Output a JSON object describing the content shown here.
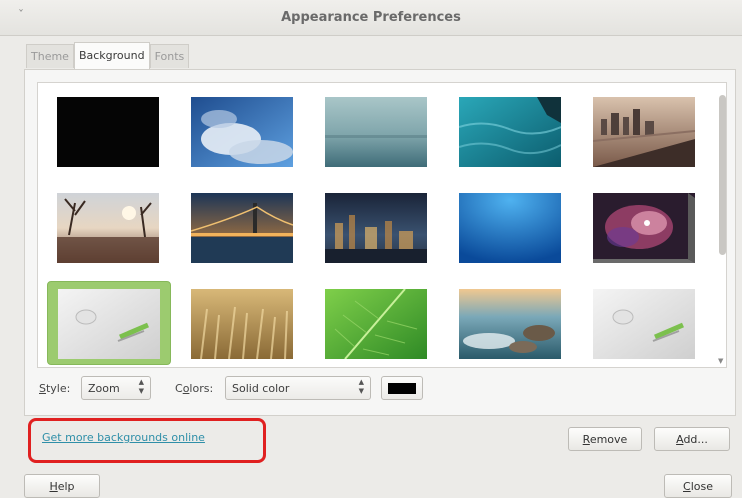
{
  "window": {
    "title": "Appearance Preferences",
    "menu_glyph": "ˇ"
  },
  "tabs": [
    {
      "label": "Theme",
      "active": false
    },
    {
      "label": "Background",
      "active": true
    },
    {
      "label": "Fonts",
      "active": false
    }
  ],
  "gallery": {
    "selected_index": 10,
    "thumbnails": [
      {
        "icon": "black-solid"
      },
      {
        "icon": "blue-sky-clouds"
      },
      {
        "icon": "misty-sea"
      },
      {
        "icon": "teal-water-boat"
      },
      {
        "icon": "city-bridge-sepia"
      },
      {
        "icon": "river-sunset-trees"
      },
      {
        "icon": "bridge-at-dusk"
      },
      {
        "icon": "city-skyline-night"
      },
      {
        "icon": "underwater-blue"
      },
      {
        "icon": "orion-nebula"
      },
      {
        "icon": "linux-mint-logo-gray"
      },
      {
        "icon": "wheat-field"
      },
      {
        "icon": "green-leaf"
      },
      {
        "icon": "sea-rocks-sunset"
      },
      {
        "icon": "linux-mint-logo-gray"
      }
    ]
  },
  "controls": {
    "style_label_prefix": "",
    "style_label_u": "S",
    "style_label_rest": "tyle:",
    "style_value": "Zoom",
    "colors_label_prefix": "C",
    "colors_label_u": "o",
    "colors_label_rest": "lors:",
    "colors_value": "Solid color",
    "swatch_color": "#000000"
  },
  "link": {
    "text": "Get more backgrounds online"
  },
  "buttons": {
    "remove_u": "R",
    "remove_rest": "emove",
    "add_u": "A",
    "add_rest": "dd...",
    "help_u": "H",
    "help_rest": "elp",
    "close_u": "C",
    "close_rest": "lose"
  },
  "colors": {
    "selection": "#9ccb6f",
    "link": "#2f8fa8",
    "highlight": "#e02020"
  }
}
